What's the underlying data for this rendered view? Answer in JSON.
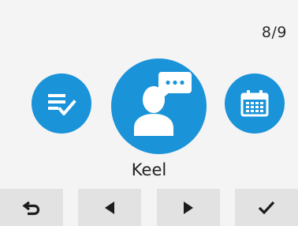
{
  "status": {
    "page_indicator": "8/9"
  },
  "carousel": {
    "items": [
      {
        "name": "checklist-icon"
      },
      {
        "name": "contact-message-icon"
      },
      {
        "name": "calendar-icon"
      }
    ],
    "selected_label": "Keel"
  },
  "softkeys": [
    {
      "name": "back-arrow-icon"
    },
    {
      "name": "left-arrow-icon"
    },
    {
      "name": "right-arrow-icon"
    },
    {
      "name": "check-icon"
    }
  ],
  "colors": {
    "accent": "#1a93d9",
    "background": "#f4f4f4",
    "softkey": "#e2e2e2",
    "text": "#222222"
  }
}
